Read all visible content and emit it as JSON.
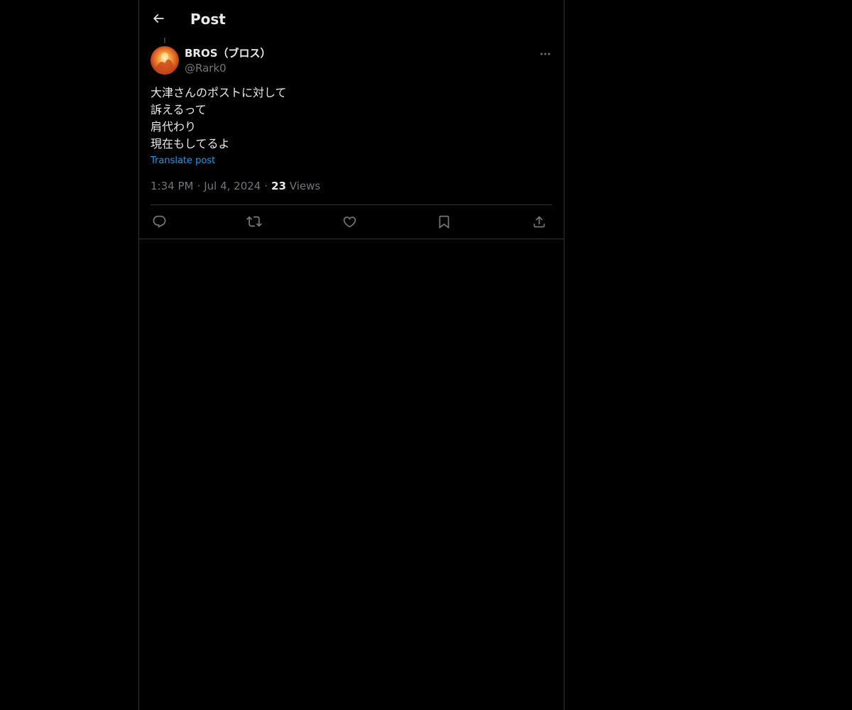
{
  "header": {
    "title": "Post"
  },
  "post": {
    "author": {
      "name": "BROS（ブロス）",
      "handle": "@Rark0"
    },
    "lines": [
      "大津さんのポストに対して",
      "訴えるって",
      "肩代わり",
      "現在もしてるよ"
    ],
    "translate_label": "Translate post",
    "time": "1:34 PM",
    "date": "Jul 4, 2024",
    "separator": "·",
    "views_count": "23",
    "views_label": "Views"
  },
  "icons": {
    "back": "arrow-left-icon",
    "more": "more-horizontal-icon",
    "reply": "reply-icon",
    "repost": "repost-icon",
    "like": "heart-icon",
    "bookmark": "bookmark-icon",
    "share": "share-icon"
  },
  "colors": {
    "background": "#000000",
    "text": "#e7e9ea",
    "secondary_text": "#71767b",
    "link": "#1d9bf0",
    "border": "#2f3336"
  }
}
